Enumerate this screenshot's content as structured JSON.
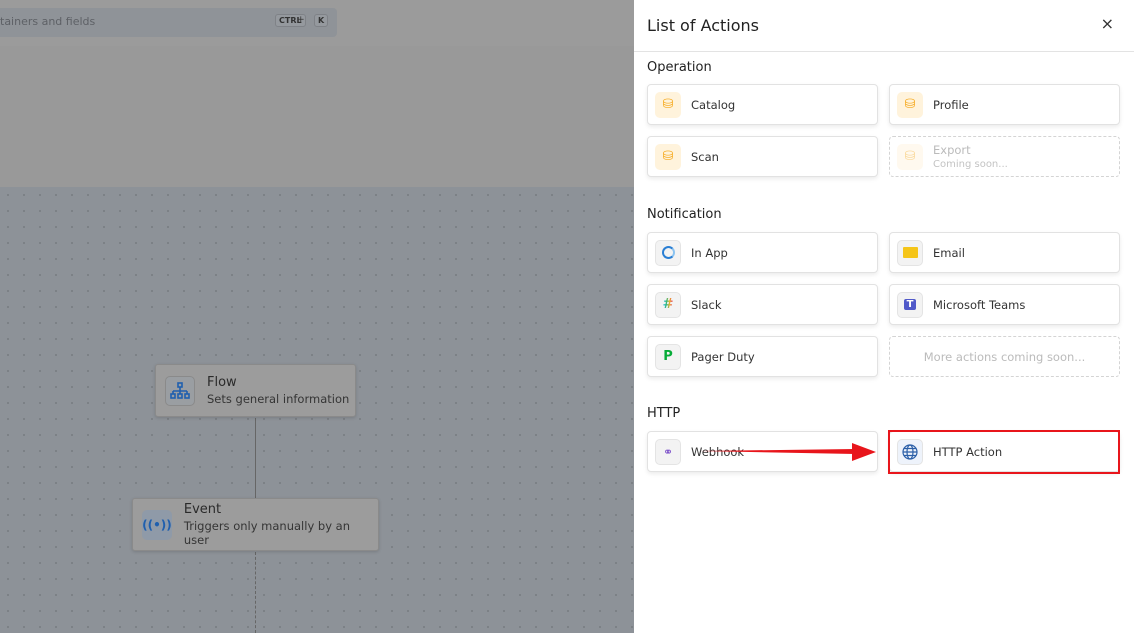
{
  "background": {
    "search_placeholder": "tainers and fields",
    "shortcut": {
      "key1": "CTRL",
      "plus": "+",
      "key2": "K"
    },
    "nodes": [
      {
        "title": "Flow",
        "subtitle": "Sets general information",
        "icon": "sitemap-icon"
      },
      {
        "title": "Event",
        "subtitle": "Triggers only manually by an user",
        "icon": "broadcast-icon"
      }
    ]
  },
  "panel": {
    "title": "List of Actions",
    "close_icon": "×",
    "sections": [
      {
        "label": "Operation",
        "items": [
          {
            "label": "Catalog",
            "icon": "database-icon"
          },
          {
            "label": "Profile",
            "icon": "database-eye-icon"
          },
          {
            "label": "Scan",
            "icon": "database-search-icon"
          },
          {
            "label": "Export",
            "sub": "Coming soon...",
            "icon": "database-export-icon",
            "disabled": true
          }
        ]
      },
      {
        "label": "Notification",
        "items": [
          {
            "label": "In App",
            "icon": "in-app-icon"
          },
          {
            "label": "Email",
            "icon": "email-icon"
          },
          {
            "label": "Slack",
            "icon": "slack-icon"
          },
          {
            "label": "Microsoft Teams",
            "icon": "teams-icon"
          },
          {
            "label": "Pager Duty",
            "icon": "pagerduty-icon"
          },
          {
            "label": "More actions coming soon...",
            "disabled": true
          }
        ]
      },
      {
        "label": "HTTP",
        "items": [
          {
            "label": "Webhook",
            "icon": "webhook-icon"
          },
          {
            "label": "HTTP Action",
            "icon": "globe-icon",
            "highlighted": true
          }
        ]
      }
    ]
  },
  "colors": {
    "accent": "#f6a91d",
    "highlight": "#e8151b"
  }
}
